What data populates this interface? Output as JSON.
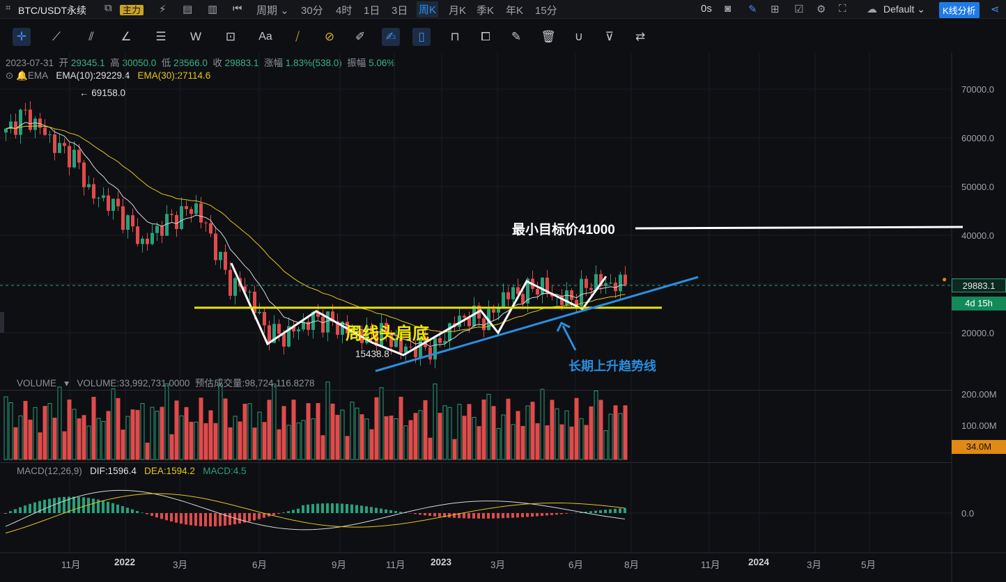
{
  "topbar": {
    "symbol": "BTC/USDT永续",
    "main_label": "主力",
    "period_label": "周期",
    "intervals": [
      "30分",
      "4时",
      "1日",
      "3日",
      "周K",
      "月K",
      "季K",
      "年K",
      "15分"
    ],
    "active_interval": "周K",
    "timer": "0s",
    "theme": "Default",
    "kline_analysis": "K线分析"
  },
  "ohlc": {
    "date": "2023-07-31",
    "open_label": "开",
    "open": "29345.1",
    "high_label": "高",
    "high": "30050.0",
    "low_label": "低",
    "low": "28566.0",
    "close_label": "收",
    "close": "29883.1",
    "change_label": "涨幅",
    "change": "1.83%(538.0)",
    "amp_label": "振幅",
    "amp": "5.06%"
  },
  "ema": {
    "name": "EMA",
    "ema10": "EMA(10):29229.4",
    "ema30": "EMA(30):27114.6"
  },
  "price_axis": {
    "labels": [
      "70000.0",
      "60000.0",
      "50000.0",
      "40000.0",
      "20000.0"
    ],
    "current": "29883.1",
    "countdown": "4d 15h"
  },
  "annotations": {
    "high_mark": "← 69158.0",
    "low_mark": "15438.8",
    "target": "最小目标价41000",
    "pattern": "周线头肩底",
    "trend": "长期上升趋势线"
  },
  "volume": {
    "name": "VOLUME",
    "value": "VOLUME:33,992,731.0000",
    "estimate": "预估成交量:98,724,116.8278",
    "axis": [
      "200.00M",
      "100.00M"
    ],
    "current": "34.0M"
  },
  "macd": {
    "name": "MACD(12,26,9)",
    "dif": "DIF:1596.4",
    "dea": "DEA:1594.2",
    "macd": "MACD:4.5",
    "axis": "0.0"
  },
  "x_axis": [
    "11月",
    "2022",
    "3月",
    "6月",
    "9月",
    "11月",
    "2023",
    "3月",
    "6月",
    "8月",
    "11月",
    "2024",
    "3月",
    "5月"
  ],
  "colors": {
    "up": "#26a17b",
    "down": "#e04b4b",
    "ema10": "#d9d9d9",
    "ema30": "#e6c619",
    "trend": "#2a8fe0",
    "neckline": "#e6e600",
    "target": "#ffffff"
  },
  "chart_data": {
    "type": "candlestick",
    "timeframe": "weekly",
    "closes_sampled": [
      61000,
      65000,
      62000,
      58000,
      56000,
      48000,
      47000,
      43000,
      38000,
      42000,
      44000,
      46000,
      39000,
      30000,
      29000,
      21000,
      19000,
      21000,
      23000,
      22000,
      20000,
      19500,
      20000,
      16500,
      17000,
      16800,
      22000,
      23500,
      22500,
      28000,
      28000,
      30000,
      27000,
      27000,
      30500,
      30000,
      29883
    ],
    "high": 69158.0,
    "low": 15438.8,
    "target_price": 41000,
    "neckline_price": 25200
  }
}
